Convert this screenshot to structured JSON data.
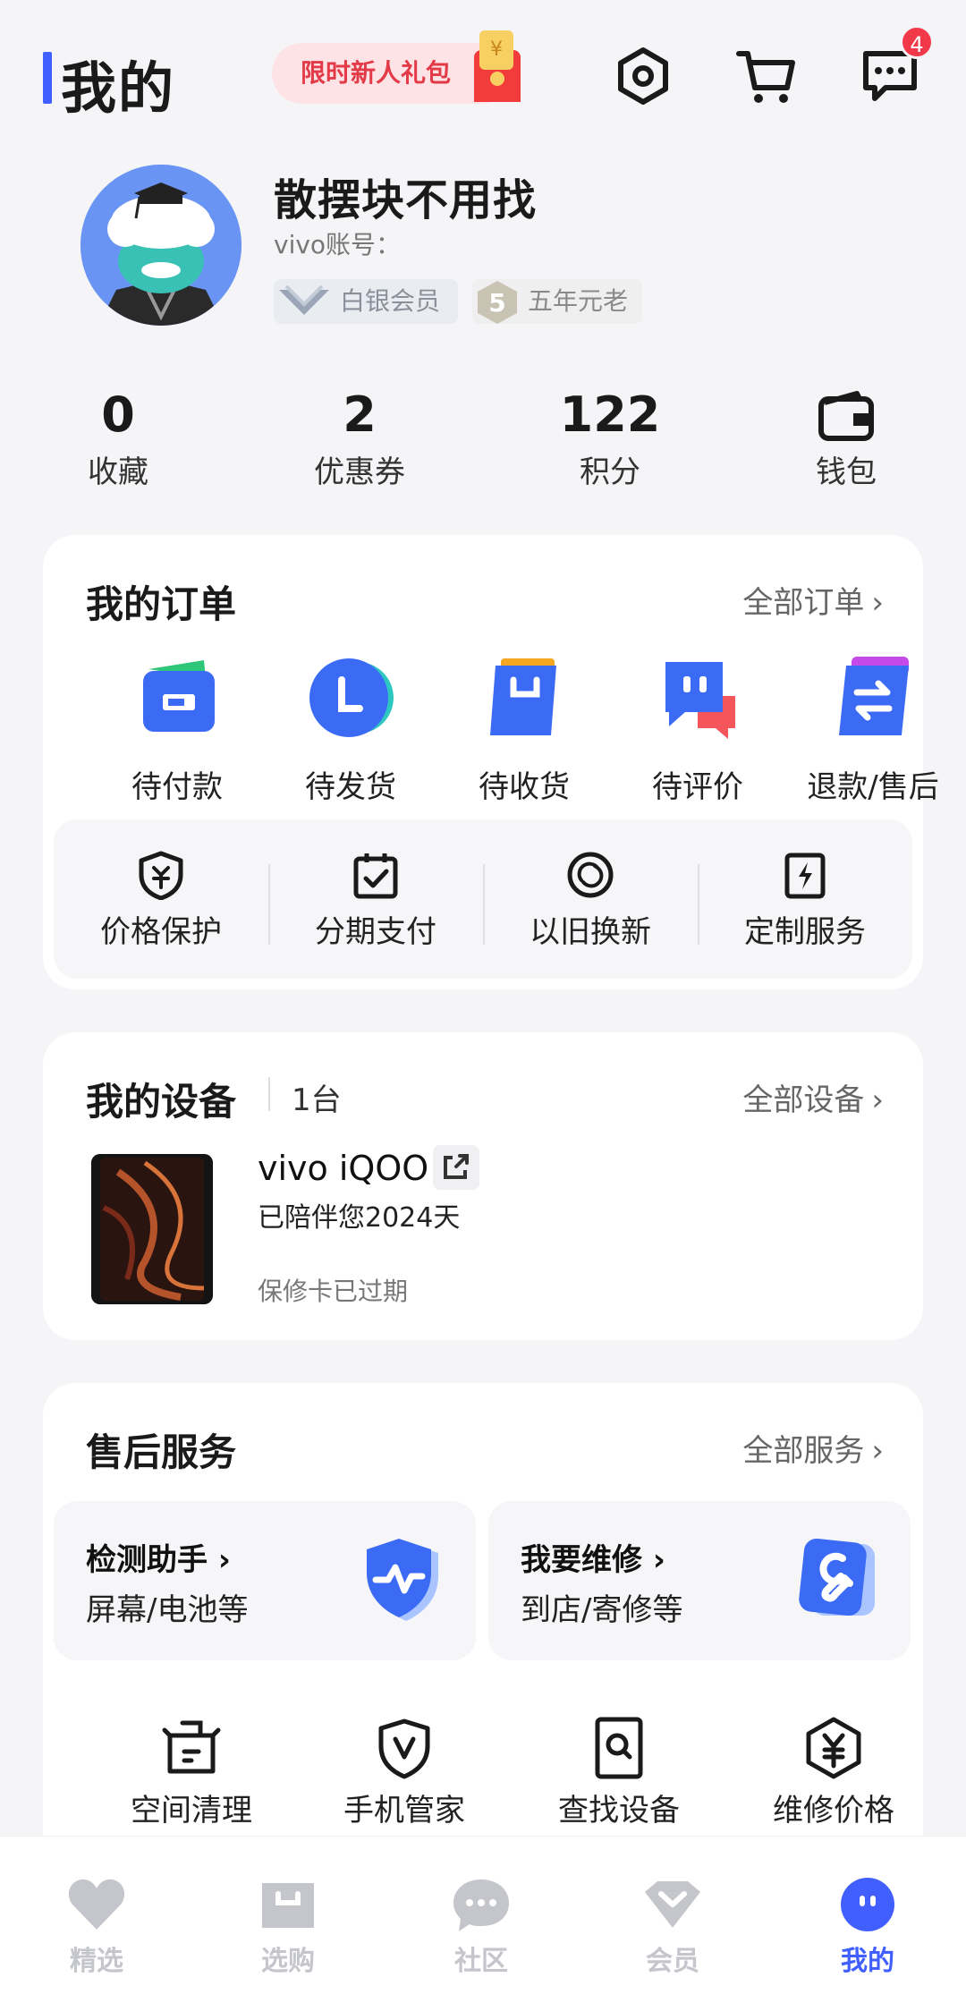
{
  "header": {
    "title": "我的",
    "promo_label": "限时新人礼包",
    "message_badge": "4"
  },
  "profile": {
    "name": "散摆块不用找",
    "account_label": "vivo账号：",
    "tags": [
      "白银会员",
      "五年元老"
    ]
  },
  "stats": [
    {
      "value": "0",
      "label": "收藏"
    },
    {
      "value": "2",
      "label": "优惠券"
    },
    {
      "value": "122",
      "label": "积分"
    },
    {
      "label": "钱包"
    }
  ],
  "orders": {
    "title": "我的订单",
    "more": "全部订单",
    "items": [
      "待付款",
      "待发货",
      "待收货",
      "待评价",
      "退款/售后"
    ],
    "services": [
      "价格保护",
      "分期支付",
      "以旧换新",
      "定制服务"
    ]
  },
  "devices": {
    "title": "我的设备",
    "count": "1台",
    "more": "全部设备",
    "device_name": "vivo iQOO",
    "days": "已陪伴您2024天",
    "warranty": "保修卡已过期"
  },
  "after_sales": {
    "title": "售后服务",
    "more": "全部服务",
    "boxes": [
      {
        "title": "检测助手",
        "subtitle": "屏幕/电池等"
      },
      {
        "title": "我要维修",
        "subtitle": "到店/寄修等"
      }
    ],
    "tools": [
      "空间清理",
      "手机管家",
      "查找设备",
      "维修价格"
    ]
  },
  "nav": {
    "items": [
      "精选",
      "选购",
      "社区",
      "会员",
      "我的"
    ],
    "active": "我的"
  },
  "colors": {
    "accent": "#415fff",
    "badge": "#f2394a",
    "promo_bg": "#fde3e5",
    "promo_text": "#e33a48"
  }
}
